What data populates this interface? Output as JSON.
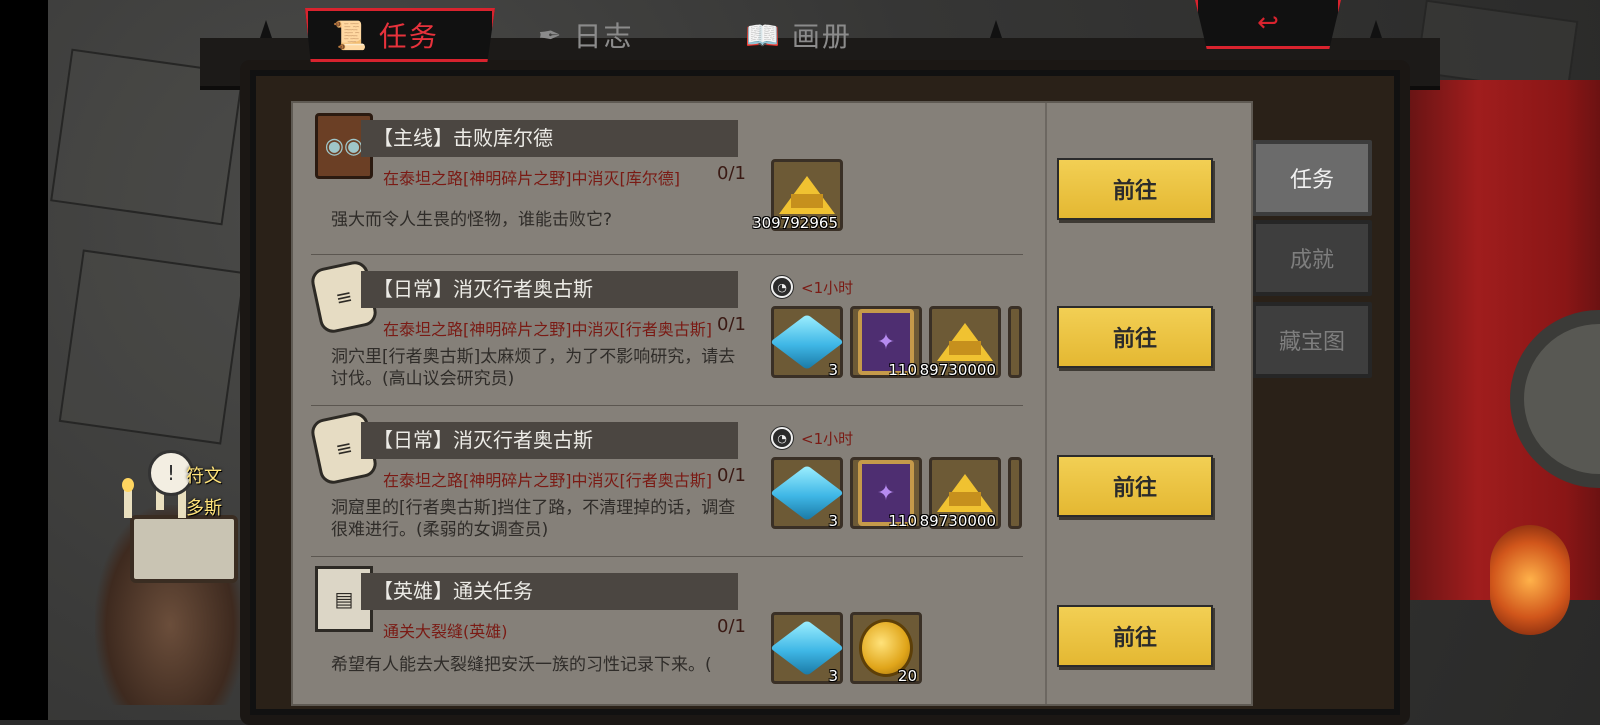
{
  "tabs": {
    "active": {
      "label": "任务",
      "icon": "scroll-icon"
    },
    "log": {
      "label": "日志",
      "icon": "feather-icon"
    },
    "album": {
      "label": "画册",
      "icon": "book-icon"
    }
  },
  "side_tabs": [
    {
      "label": "任务",
      "active": true
    },
    {
      "label": "成就",
      "active": false
    },
    {
      "label": "藏宝图",
      "active": false
    }
  ],
  "npc": {
    "line1": "符文",
    "line2": "多斯"
  },
  "quests": [
    {
      "title": "【主线】击败库尔德",
      "objective": "在泰坦之路[神明碎片之野]中消灭[库尔德]",
      "progress": "0/1",
      "desc": "强大而令人生畏的怪物，谁能击败它?",
      "timer": "",
      "rewards": [
        {
          "type": "xp",
          "qty": "309792965"
        }
      ],
      "button": "前往"
    },
    {
      "title": "【日常】消灭行者奥古斯",
      "objective": "在泰坦之路[神明碎片之野]中消灭[行者奥古斯]",
      "progress": "0/1",
      "desc": "洞穴里[行者奥古斯]太麻烦了，为了不影响研究，请去讨伐。(高山议会研究员)",
      "timer": "<1小时",
      "rewards": [
        {
          "type": "crystal",
          "qty": "3"
        },
        {
          "type": "tome",
          "qty": "110"
        },
        {
          "type": "xp",
          "qty": "89730000"
        }
      ],
      "button": "前往"
    },
    {
      "title": "【日常】消灭行者奥古斯",
      "objective": "在泰坦之路[神明碎片之野]中消灭[行者奥古斯]",
      "progress": "0/1",
      "desc": "洞窟里的[行者奥古斯]挡住了路，不清理掉的话，调查很难进行。(柔弱的女调查员)",
      "timer": "<1小时",
      "rewards": [
        {
          "type": "crystal",
          "qty": "3"
        },
        {
          "type": "tome",
          "qty": "110"
        },
        {
          "type": "xp",
          "qty": "89730000"
        }
      ],
      "button": "前往"
    },
    {
      "title": "【英雄】通关任务",
      "objective": "通关大裂缝(英雄)",
      "progress": "0/1",
      "desc": "希望有人能去大裂缝把安沃一族的习性记录下来。(",
      "timer": "",
      "rewards": [
        {
          "type": "crystal",
          "qty": "3"
        },
        {
          "type": "coin",
          "qty": "20"
        }
      ],
      "button": "前往"
    }
  ],
  "colors": {
    "accent_red": "#d9232e",
    "button_gold": "#e9bf3b",
    "panel": "#858079"
  }
}
